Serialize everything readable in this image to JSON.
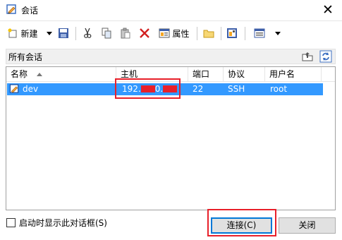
{
  "window": {
    "title": "会话",
    "close_glyph": "✕"
  },
  "toolbar": {
    "new_label": "新建",
    "properties_label": "属性",
    "icons": [
      "new-session-icon",
      "dropdown-arrow-icon",
      "save-icon",
      "cut-icon",
      "copy-icon",
      "paste-icon",
      "delete-icon",
      "properties-icon",
      "folder-icon",
      "image-icon",
      "view-icon",
      "dropdown-arrow-icon"
    ]
  },
  "pathbar": {
    "path": "所有会话"
  },
  "list": {
    "columns": [
      "名称",
      "主机",
      "端口",
      "协议",
      "用户名"
    ],
    "rows": [
      {
        "name": "dev",
        "host_prefix": "192.",
        "host_mid": "0.",
        "port": "22",
        "protocol": "SSH",
        "user": "root"
      }
    ]
  },
  "footer": {
    "show_at_startup": "启动时显示此对话框(S)",
    "show_at_startup_checked": false,
    "connect_label": "连接(C)",
    "close_label": "关闭"
  },
  "colors": {
    "selection": "#3399ff",
    "highlight": "#e8202a",
    "default_button_border": "#0078d7"
  }
}
